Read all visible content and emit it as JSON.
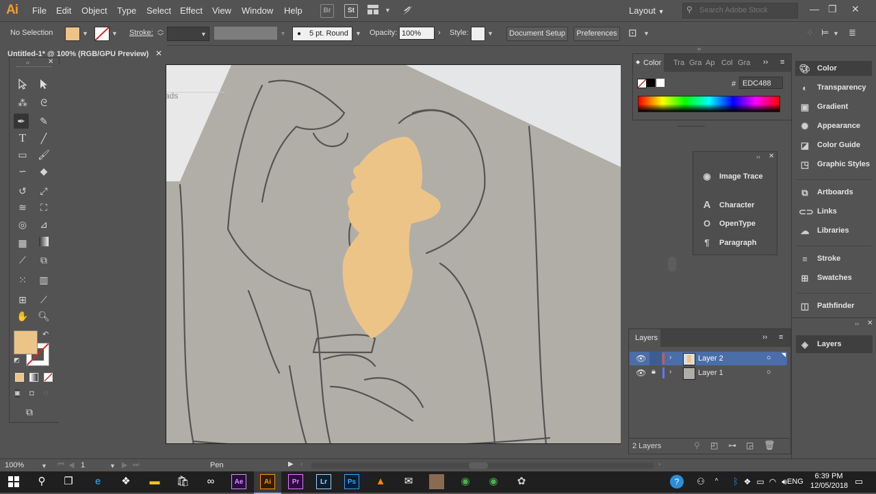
{
  "app": {
    "logo": "Ai"
  },
  "menu": [
    "File",
    "Edit",
    "Object",
    "Type",
    "Select",
    "Effect",
    "View",
    "Window",
    "Help"
  ],
  "menubar_icons": {
    "bridge": "Br",
    "stock": "St"
  },
  "workspace": {
    "label": "Layout"
  },
  "search": {
    "placeholder": "Search Adobe Stock"
  },
  "control": {
    "selection": "No Selection",
    "stroke_label": "Stroke:",
    "brush_label": "5 pt. Round",
    "opacity_label": "Opacity:",
    "opacity_value": "100%",
    "style_label": "Style:",
    "document_setup": "Document Setup",
    "preferences": "Preferences"
  },
  "document": {
    "title": "Untitled-1* @ 100% (RGB/GPU Preview)"
  },
  "canvas": {
    "partial_text": "ads"
  },
  "colors": {
    "fill": "#EDC488",
    "ui_bg": "#535353",
    "panel_dark": "#3f3f3f",
    "accent_ai": "#f59c2d",
    "layer2_color": "#e05050",
    "layer1_color": "#5a7bff"
  },
  "color_panel": {
    "tabs": [
      "Color",
      "Tra",
      "Gra",
      "Ap",
      "Col",
      "Gra"
    ],
    "hex_label": "#",
    "hex_value": "EDC488"
  },
  "float_panel": {
    "items": [
      {
        "label": "Image Trace",
        "icon": "image-trace-icon"
      },
      {
        "label": "Character",
        "icon": "character-icon"
      },
      {
        "label": "OpenType",
        "icon": "opentype-icon"
      },
      {
        "label": "Paragraph",
        "icon": "paragraph-icon"
      }
    ]
  },
  "dock": {
    "items": [
      {
        "label": "Color",
        "icon": "color-icon"
      },
      {
        "label": "Transparency",
        "icon": "transparency-icon"
      },
      {
        "label": "Gradient",
        "icon": "gradient-icon"
      },
      {
        "label": "Appearance",
        "icon": "appearance-icon"
      },
      {
        "label": "Color Guide",
        "icon": "color-guide-icon"
      },
      {
        "label": "Graphic Styles",
        "icon": "graphic-styles-icon"
      },
      {
        "label": "Artboards",
        "icon": "artboards-icon"
      },
      {
        "label": "Links",
        "icon": "links-icon"
      },
      {
        "label": "Libraries",
        "icon": "libraries-icon"
      },
      {
        "label": "Stroke",
        "icon": "stroke-icon"
      },
      {
        "label": "Swatches",
        "icon": "swatches-icon"
      },
      {
        "label": "Pathfinder",
        "icon": "pathfinder-icon"
      },
      {
        "label": "Layers",
        "icon": "layers-icon"
      }
    ]
  },
  "layers": {
    "title": "Layers",
    "rows": [
      {
        "name": "Layer 2",
        "selected": true
      },
      {
        "name": "Layer 1",
        "selected": false
      }
    ],
    "count": "2 Layers"
  },
  "status": {
    "zoom": "100%",
    "artboard": "1",
    "tool": "Pen"
  },
  "taskbar": {
    "time": "6:39 PM",
    "date": "12/05/2018",
    "lang": "ENG"
  }
}
